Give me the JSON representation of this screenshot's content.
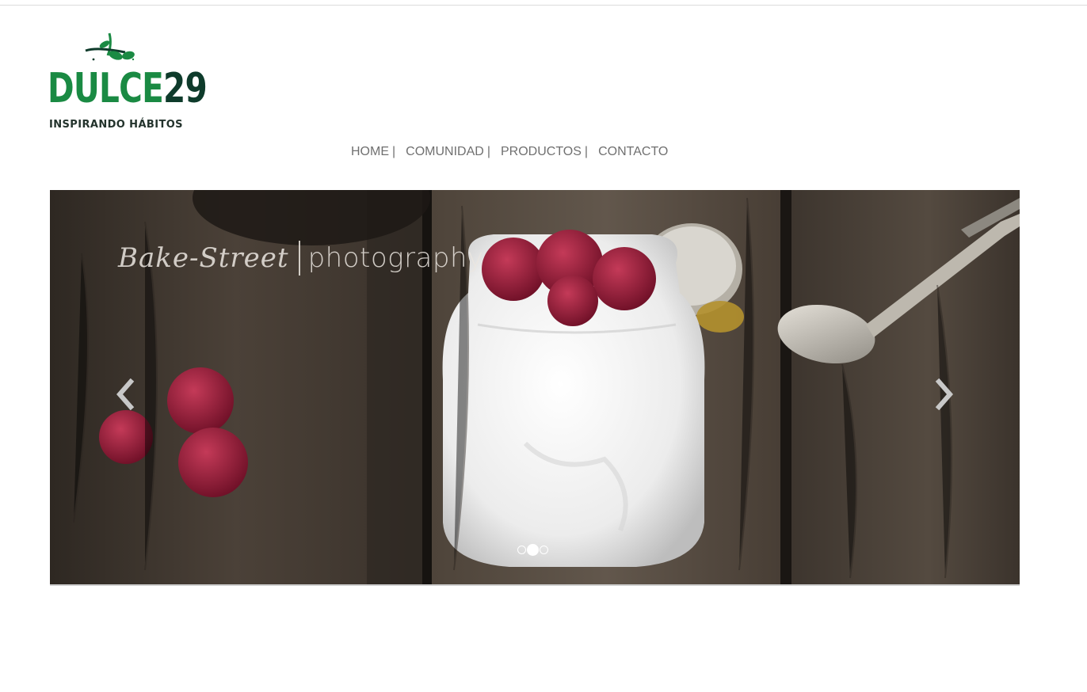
{
  "logo": {
    "word_part1": "DULCE",
    "word_part2": "29",
    "tagline": "INSPIRANDO HÁBITOS",
    "colors": {
      "green": "#1a8a43",
      "dark": "#0e3b2b"
    }
  },
  "nav": {
    "items": [
      {
        "label": "HOME",
        "separator": "|"
      },
      {
        "label": "COMUNIDAD",
        "separator": "|"
      },
      {
        "label": "PRODUCTOS",
        "separator": "|"
      },
      {
        "label": "CONTACTO",
        "separator": ""
      }
    ]
  },
  "carousel": {
    "watermark_script": "Bake-Street",
    "watermark_word": "photography",
    "prev_icon": "chevron-left-icon",
    "next_icon": "chevron-right-icon",
    "slide_count": 3,
    "active_slide": 2
  }
}
